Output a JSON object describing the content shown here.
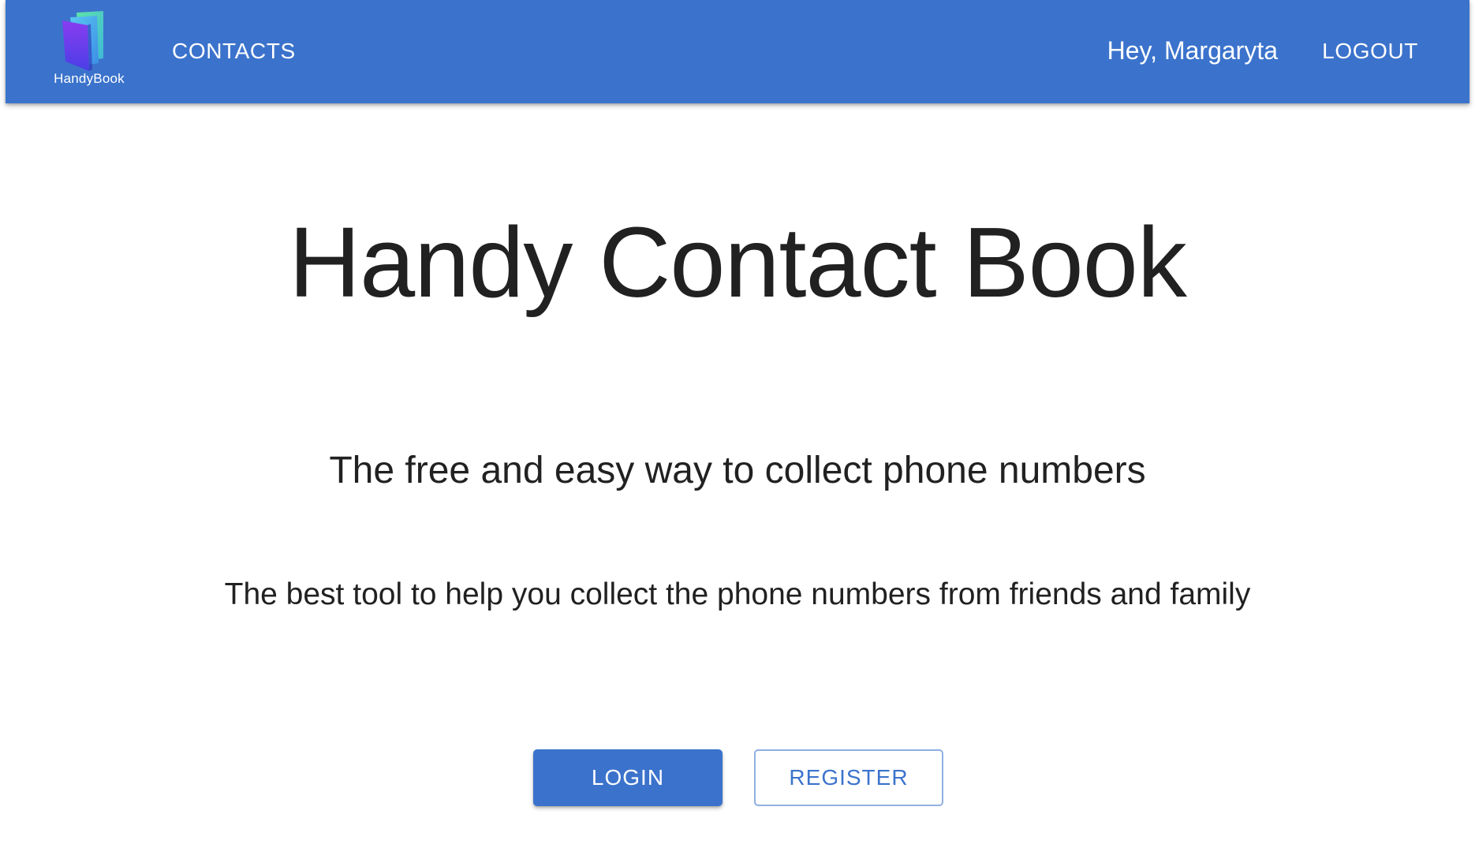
{
  "app": {
    "logo_text": "HandyBook"
  },
  "nav": {
    "contacts_label": "CONTACTS",
    "greeting": "Hey, Margaryta",
    "logout_label": "LOGOUT"
  },
  "hero": {
    "title": "Handy Contact Book",
    "tagline": "The free and easy way to collect phone numbers",
    "subtext": "The best tool to help you collect the phone numbers from friends and family"
  },
  "actions": {
    "login_label": "LOGIN",
    "register_label": "REGISTER"
  },
  "colors": {
    "primary": "#3b73cc",
    "text": "#212121",
    "background": "#ffffff",
    "outline": "#8fb0e3"
  },
  "icons": {
    "logo": "book-icon"
  }
}
